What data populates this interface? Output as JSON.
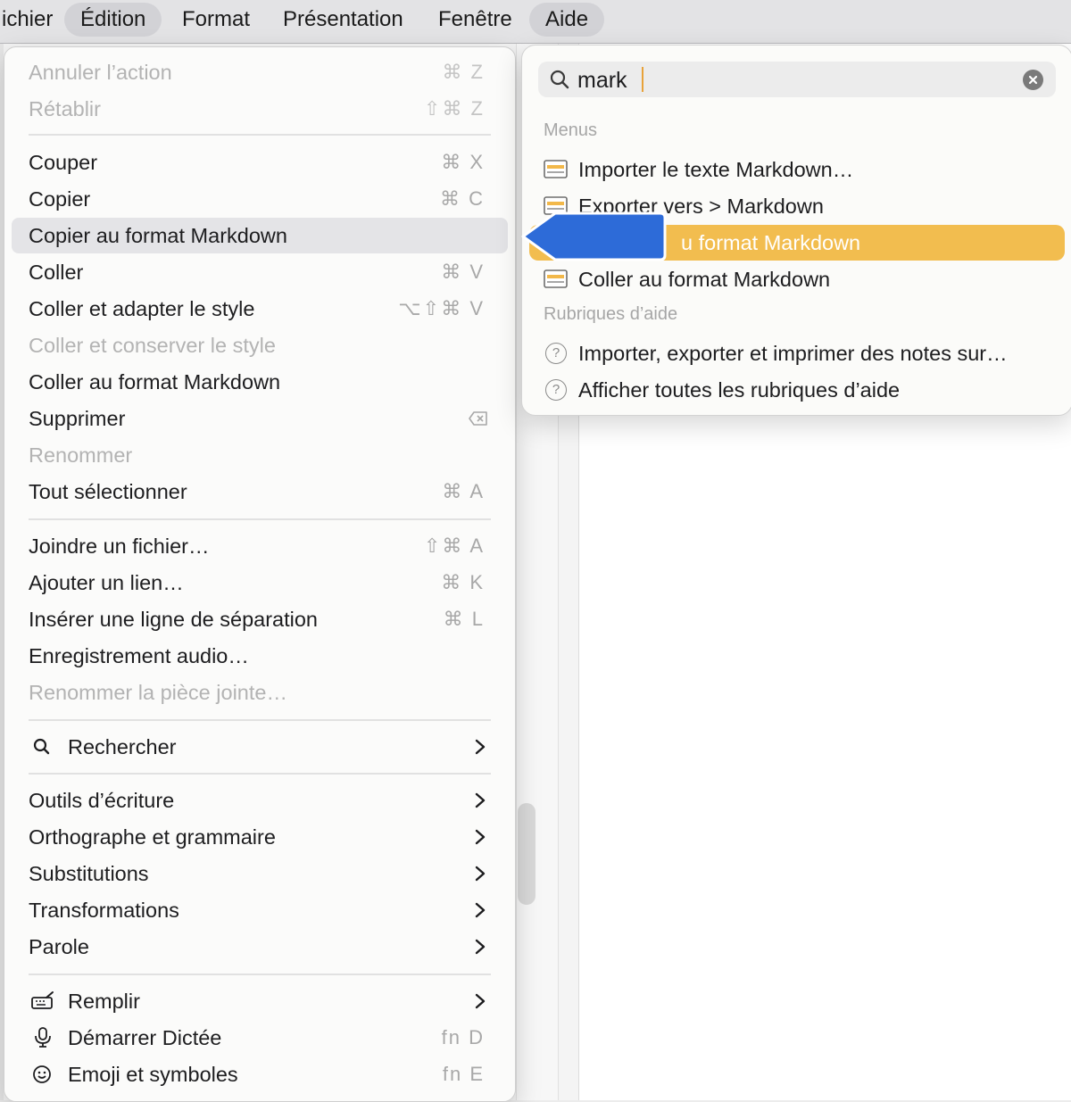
{
  "menubar": {
    "items": [
      "ichier",
      "Édition",
      "Format",
      "Présentation",
      "Fenêtre",
      "Aide"
    ]
  },
  "edit_menu": {
    "items": [
      {
        "label": "Annuler l’action",
        "shortcut": "⌘ Z",
        "enabled": false
      },
      {
        "label": "Rétablir",
        "shortcut": "⇧⌘ Z",
        "enabled": false
      },
      {
        "label": "Couper",
        "shortcut": "⌘ X",
        "enabled": true
      },
      {
        "label": "Copier",
        "shortcut": "⌘ C",
        "enabled": true
      },
      {
        "label": "Copier au format Markdown",
        "shortcut": "",
        "enabled": true,
        "highlighted": true
      },
      {
        "label": "Coller",
        "shortcut": "⌘ V",
        "enabled": true
      },
      {
        "label": "Coller et adapter le style",
        "shortcut": "⌥⇧⌘ V",
        "enabled": true
      },
      {
        "label": "Coller et conserver le style",
        "shortcut": "",
        "enabled": false
      },
      {
        "label": "Coller au format Markdown",
        "shortcut": "",
        "enabled": true
      },
      {
        "label": "Supprimer",
        "shortcut": "delete-icon",
        "enabled": true
      },
      {
        "label": "Renommer",
        "shortcut": "",
        "enabled": false
      },
      {
        "label": "Tout sélectionner",
        "shortcut": "⌘ A",
        "enabled": true
      },
      {
        "label": "Joindre un fichier…",
        "shortcut": "⇧⌘ A",
        "enabled": true
      },
      {
        "label": "Ajouter un lien…",
        "shortcut": "⌘ K",
        "enabled": true
      },
      {
        "label": "Insérer une ligne de séparation",
        "shortcut": "⌘ L",
        "enabled": true
      },
      {
        "label": "Enregistrement audio…",
        "shortcut": "",
        "enabled": true
      },
      {
        "label": "Renommer la pièce jointe…",
        "shortcut": "",
        "enabled": false
      },
      {
        "label": "Rechercher",
        "icon": "search-icon",
        "submenu": true
      },
      {
        "label": "Outils d’écriture",
        "submenu": true
      },
      {
        "label": "Orthographe et grammaire",
        "submenu": true
      },
      {
        "label": "Substitutions",
        "submenu": true
      },
      {
        "label": "Transformations",
        "submenu": true
      },
      {
        "label": "Parole",
        "submenu": true
      },
      {
        "label": "Remplir",
        "icon": "keyboard-icon",
        "submenu": true
      },
      {
        "label": "Démarrer Dictée",
        "icon": "microphone-icon",
        "shortcut": "fn D"
      },
      {
        "label": "Emoji et symboles",
        "icon": "emoji-icon",
        "shortcut": "fn E"
      }
    ]
  },
  "help_search": {
    "query": "mark",
    "menus_header": "Menus",
    "menu_results": [
      "Importer le texte Markdown…",
      "Exporter vers > Markdown",
      "u format Markdown",
      "Coller au format Markdown"
    ],
    "help_header": "Rubriques d’aide",
    "help_results": [
      "Importer, exporter et imprimer des notes sur…",
      "Afficher toutes les rubriques d’aide"
    ]
  },
  "colors": {
    "selection": "#f2bd4f",
    "pointer": "#2d6bd8",
    "menu_highlight": "#e4e4e7"
  }
}
